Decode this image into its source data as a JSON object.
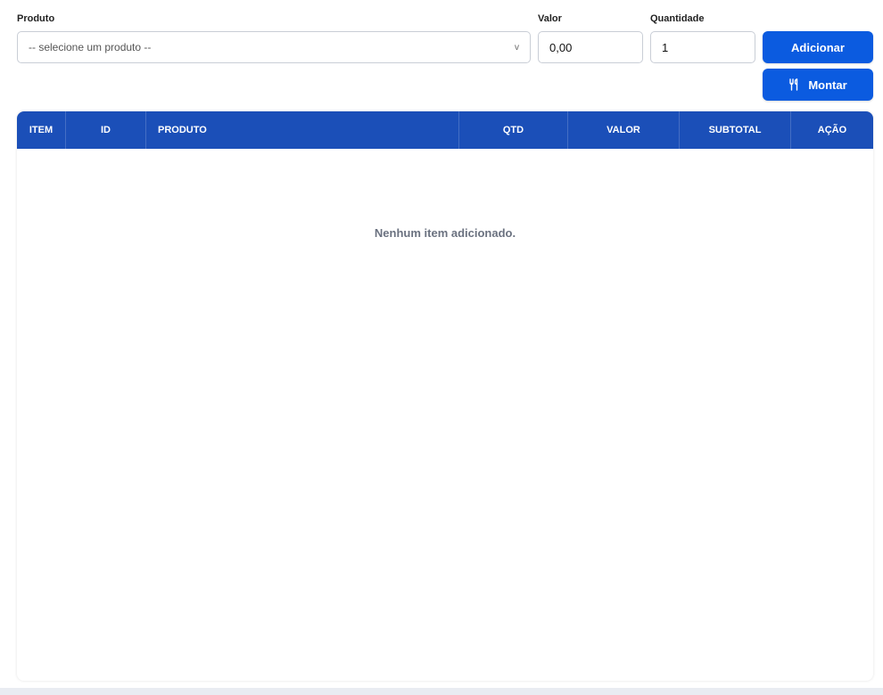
{
  "form": {
    "produto_label": "Produto",
    "produto_placeholder": "-- selecione um produto --",
    "valor_label": "Valor",
    "valor_value": "0,00",
    "quantidade_label": "Quantidade",
    "quantidade_value": "1"
  },
  "actions": {
    "adicionar_label": "Adicionar",
    "montar_label": "Montar",
    "montar_icon": "utensils-icon"
  },
  "table": {
    "headers": [
      "ITEM",
      "ID",
      "PRODUTO",
      "QTD",
      "VALOR",
      "SUBTOTAL",
      "AÇÃO"
    ],
    "empty_message": "Nenhum item adicionado."
  },
  "colors": {
    "primary_button": "#0b5be0",
    "table_header": "#1b4fb8"
  }
}
